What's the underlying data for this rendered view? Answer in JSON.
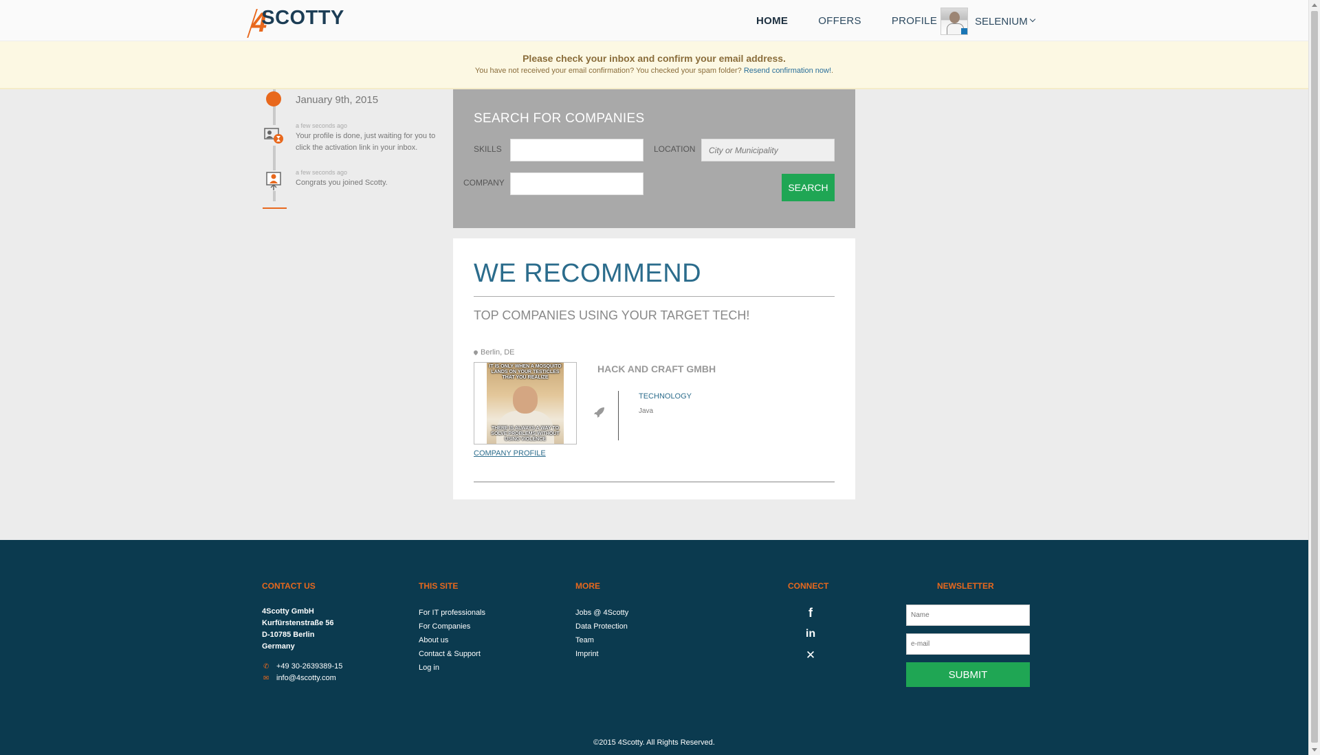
{
  "brand": {
    "logo_four": "4",
    "logo_text": "SCOTTY",
    "accent": "#e8681d",
    "dark": "#0b3a4f",
    "green": "#1fa654",
    "link": "#2b6c8c"
  },
  "nav": {
    "items": [
      {
        "label": "HOME",
        "active": true
      },
      {
        "label": "OFFERS",
        "active": false
      },
      {
        "label": "PROFILE",
        "active": false
      }
    ],
    "user_name": "SELENIUM"
  },
  "notice": {
    "title": "Please check your inbox and confirm your email address.",
    "text": "You have not received your email confirmation? You checked your spam folder?",
    "link": "Resend confirmation now!",
    "suffix": "."
  },
  "timeline": {
    "date": "January 9th, 2015",
    "items": [
      {
        "ago": "a few seconds ago",
        "message": "Your profile is done, just waiting for you to click the activation link in your inbox.",
        "icon": "profile-pending-icon"
      },
      {
        "ago": "a few seconds ago",
        "message": "Congrats you joined Scotty.",
        "icon": "user-joined-icon"
      }
    ]
  },
  "search": {
    "title": "SEARCH FOR COMPANIES",
    "skills_label": "SKILLS",
    "skills_value": "",
    "location_label": "LOCATION",
    "location_placeholder": "City or Municipality",
    "company_label": "COMPANY",
    "company_value": "",
    "button": "SEARCH"
  },
  "recommend": {
    "title": "WE RECOMMEND",
    "subtitle": "TOP COMPANIES USING YOUR TARGET TECH!",
    "company": {
      "location": "Berlin, DE",
      "name": "HACK AND CRAFT GMBH",
      "image_caption_top": "IT IS ONLY WHEN A MOSQUITO LANDS ON YOUR TESTICLES THAT YOU REALIZE",
      "image_caption_bottom": "THERE IS ALWAYS A WAY TO SOLVE PROBLEMS WITHOUT USING VIOLENCE",
      "profile_link": "COMPANY PROFILE",
      "tech_label": "TECHNOLOGY",
      "tech_value": "Java"
    }
  },
  "footer": {
    "contact": {
      "heading": "CONTACT US",
      "lines": [
        "4Scotty GmbH",
        "Kurfürstenstraße 56",
        "D-10785 Berlin",
        "Germany"
      ],
      "phone": "+49 30-2639389-15",
      "email": "info@4scotty.com"
    },
    "site": {
      "heading": "THIS SITE",
      "links": [
        "For IT professionals",
        "For Companies",
        "About us",
        "Contact & Support",
        "Log in"
      ]
    },
    "more": {
      "heading": "MORE",
      "links": [
        "Jobs @ 4Scotty",
        "Data Protection",
        "Team",
        "Imprint"
      ]
    },
    "connect": {
      "heading": "CONNECT",
      "icons": [
        "facebook-icon",
        "linkedin-icon",
        "xing-icon"
      ],
      "glyphs": [
        "f",
        "in",
        "✕"
      ]
    },
    "newsletter": {
      "heading": "NEWSLETTER",
      "name_placeholder": "Name",
      "email_placeholder": "e-mail",
      "button": "SUBMIT"
    },
    "copyright": "©2015 4Scotty. All Rights Reserved."
  }
}
